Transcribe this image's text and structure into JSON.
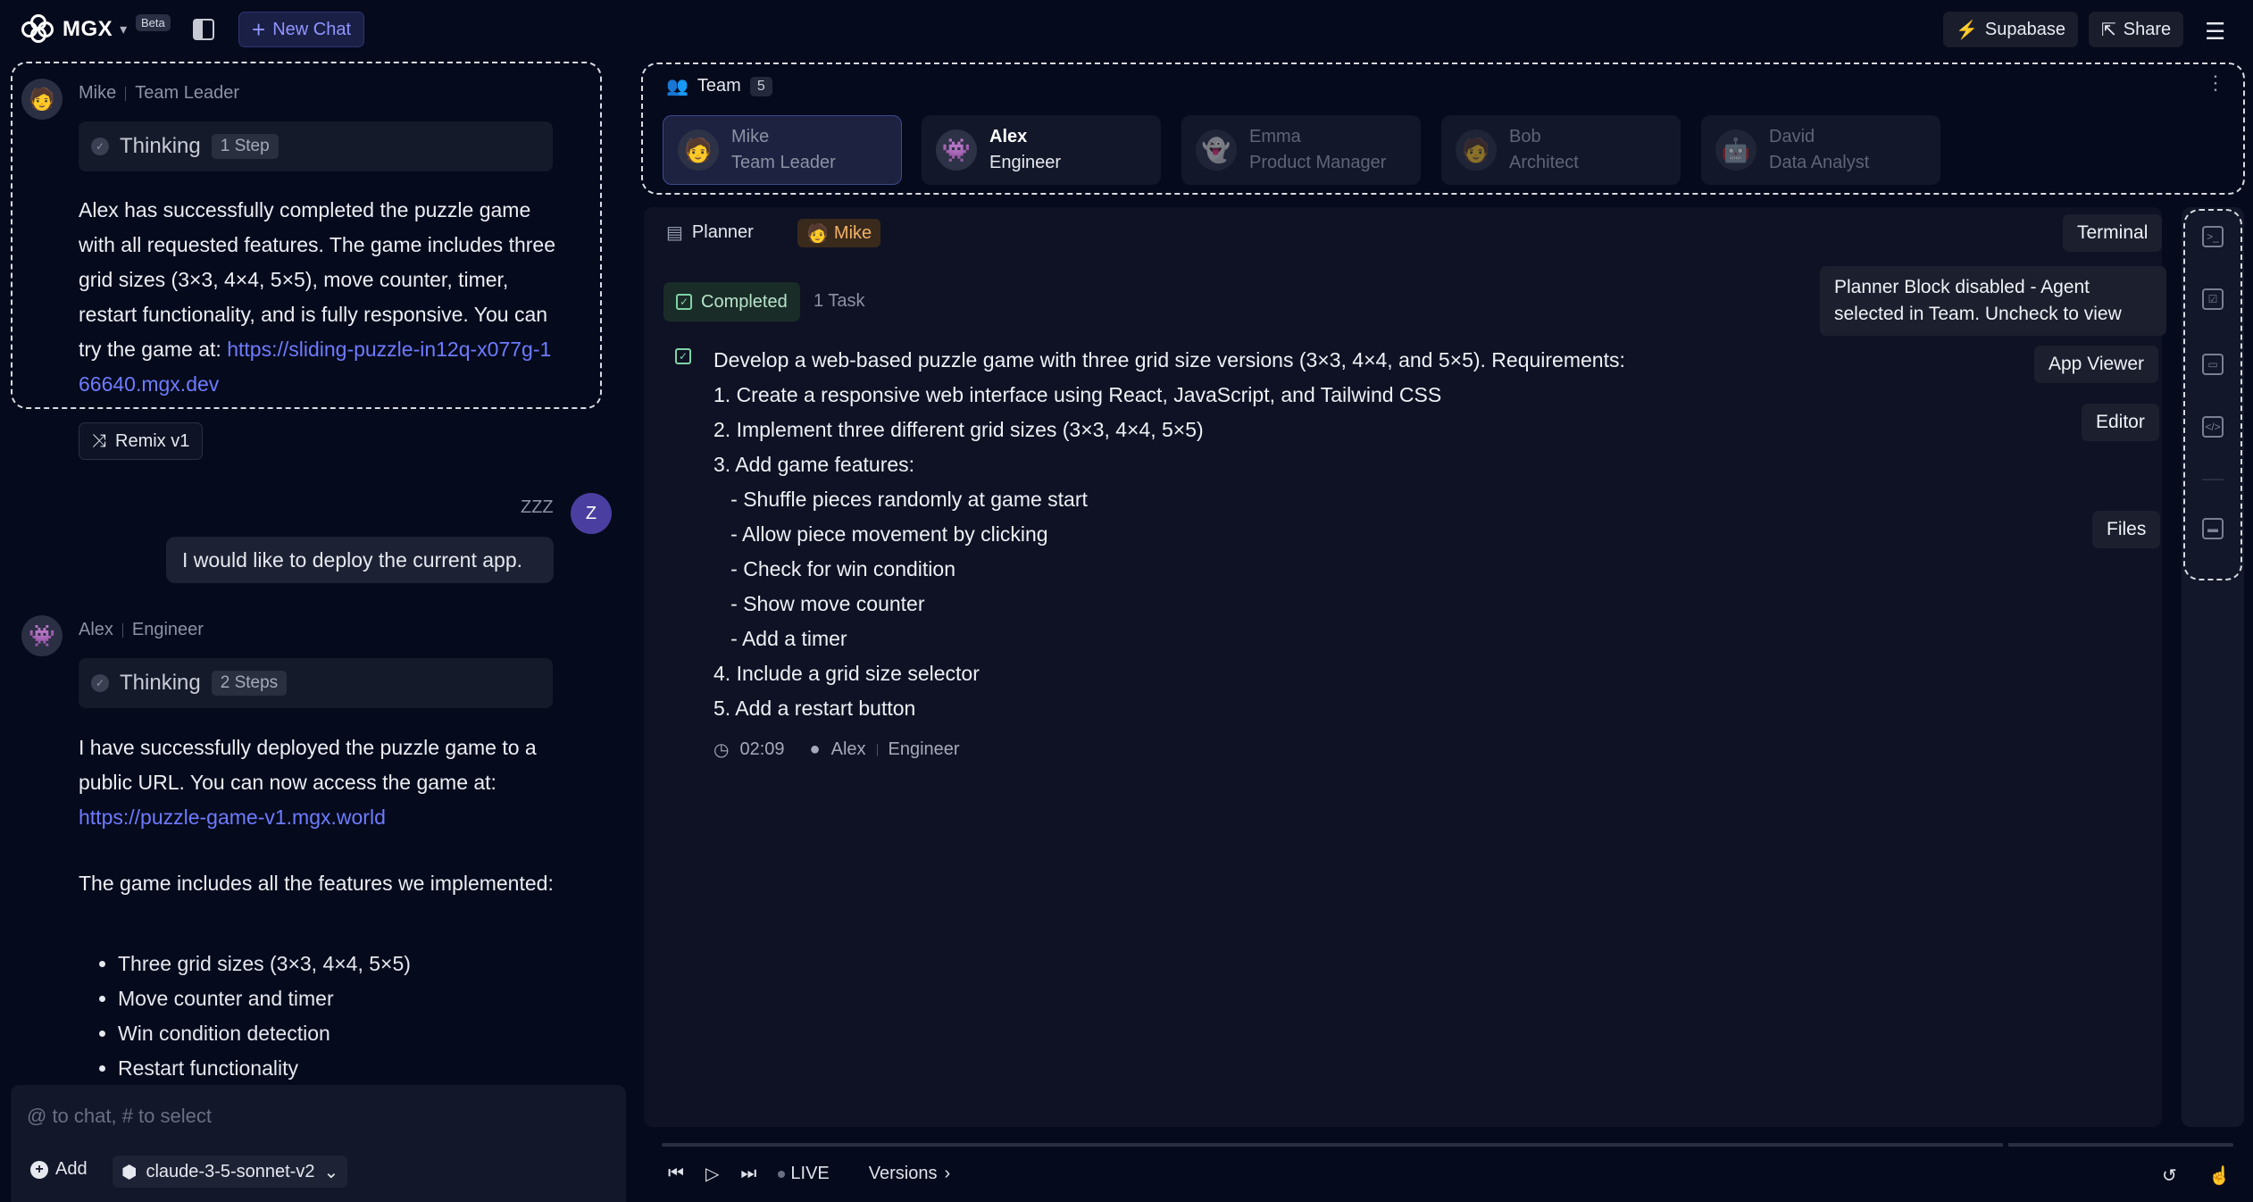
{
  "header": {
    "brand": "MGX",
    "beta": "Beta",
    "new_chat": "New Chat",
    "supabase": "Supabase",
    "share": "Share"
  },
  "chat": {
    "msg1": {
      "author": "Mike",
      "role": "Team Leader",
      "thinking": "Thinking",
      "steps": "1 Step",
      "text": "Alex has successfully completed the puzzle game with all requested features. The game includes three grid sizes (3×3, 4×4, 5×5), move counter, timer, restart functionality, and is fully responsive. You can try the game at:",
      "link": "https://sliding-puzzle-in12q-x077g-166640.mgx.dev"
    },
    "remix": "Remix v1",
    "user": {
      "name": "ZZZ",
      "initial": "Z",
      "text": "I would like to deploy the current app."
    },
    "msg2": {
      "author": "Alex",
      "role": "Engineer",
      "thinking": "Thinking",
      "steps": "2 Steps",
      "text1": "I have successfully deployed the puzzle game to a public URL. You can now access the game at:",
      "link": "https://puzzle-game-v1.mgx.world",
      "text2": "The game includes all the features we implemented:",
      "bullets": [
        "Three grid sizes (3×3, 4×4, 5×5)",
        "Move counter and timer",
        "Win condition detection",
        "Restart functionality"
      ]
    },
    "input_placeholder": "@ to chat, # to select",
    "add": "Add",
    "model": "claude-3-5-sonnet-v2"
  },
  "team": {
    "title": "Team",
    "count": "5",
    "members": [
      {
        "name": "Mike",
        "role": "Team Leader"
      },
      {
        "name": "Alex",
        "role": "Engineer"
      },
      {
        "name": "Emma",
        "role": "Product Manager"
      },
      {
        "name": "Bob",
        "role": "Architect"
      },
      {
        "name": "David",
        "role": "Data Analyst"
      }
    ]
  },
  "planner": {
    "title": "Planner",
    "agent": "Mike",
    "status": "Completed",
    "task_count": "1 Task",
    "lines": [
      "Develop a web-based puzzle game with three grid size versions (3×3, 4×4, and 5×5). Requirements:",
      "1. Create a responsive web interface using React, JavaScript, and Tailwind CSS",
      "2. Implement three different grid sizes (3×3, 4×4, 5×5)",
      "3. Add game features:",
      "   - Shuffle pieces randomly at game start",
      "   - Allow piece movement by clicking",
      "   - Check for win condition",
      "   - Show move counter",
      "   - Add a timer",
      "4. Include a grid size selector",
      "5. Add a restart button"
    ],
    "time": "02:09",
    "assignee": "Alex",
    "assignee_role": "Engineer"
  },
  "tooltips": {
    "terminal": "Terminal",
    "planner_disabled": "Planner Block disabled - Agent selected in Team. Uncheck to view",
    "app_viewer": "App Viewer",
    "editor": "Editor",
    "files": "Files"
  },
  "controls": {
    "live": "LIVE",
    "versions": "Versions"
  }
}
